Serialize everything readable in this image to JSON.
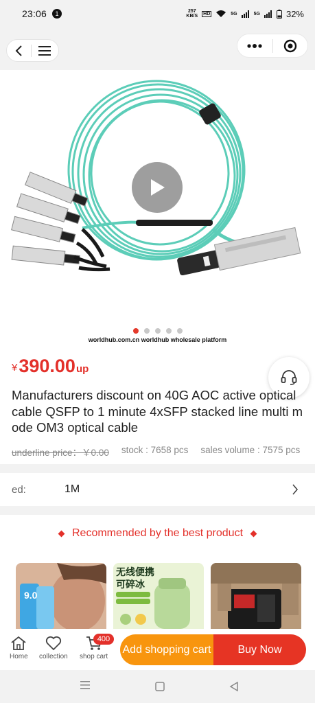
{
  "status_bar": {
    "time": "23:06",
    "notification_count": "1",
    "net_speed_value": "257",
    "net_speed_unit": "KB/S",
    "hd_label": "HD",
    "signal1": "5G",
    "signal2": "5G",
    "battery": "32%"
  },
  "hero": {
    "watermark": "worldhub.com.cn worldhub wholesale platform",
    "slide_count": 5,
    "active_slide": 1
  },
  "product": {
    "currency": "¥",
    "price": "390.00",
    "price_suffix": "up",
    "title": "Manufacturers discount on 40G AOC active optical cable QSFP to 1 minute 4xSFP stacked line multi mode OM3 optical cable",
    "underline_price": "underline price：￥0.00",
    "stock": "stock : 7658 pcs",
    "sales": "sales volume : 7575 pcs"
  },
  "spec": {
    "label": "ed:",
    "value": "1M"
  },
  "recommend": {
    "title": "Recommended by the best product",
    "thumb2_line1": "无线便携",
    "thumb2_line2": "可碎冰"
  },
  "bottom_bar": {
    "home": "Home",
    "collection": "collection",
    "shop_cart": "shop cart",
    "cart_count": "400",
    "add_cart": "Add shopping cart",
    "buy_now": "Buy Now"
  },
  "colors": {
    "accent_red": "#e3302a",
    "cable_teal": "#5ccdb8",
    "cart_orange": "#f8950e",
    "buy_red": "#e63424"
  }
}
